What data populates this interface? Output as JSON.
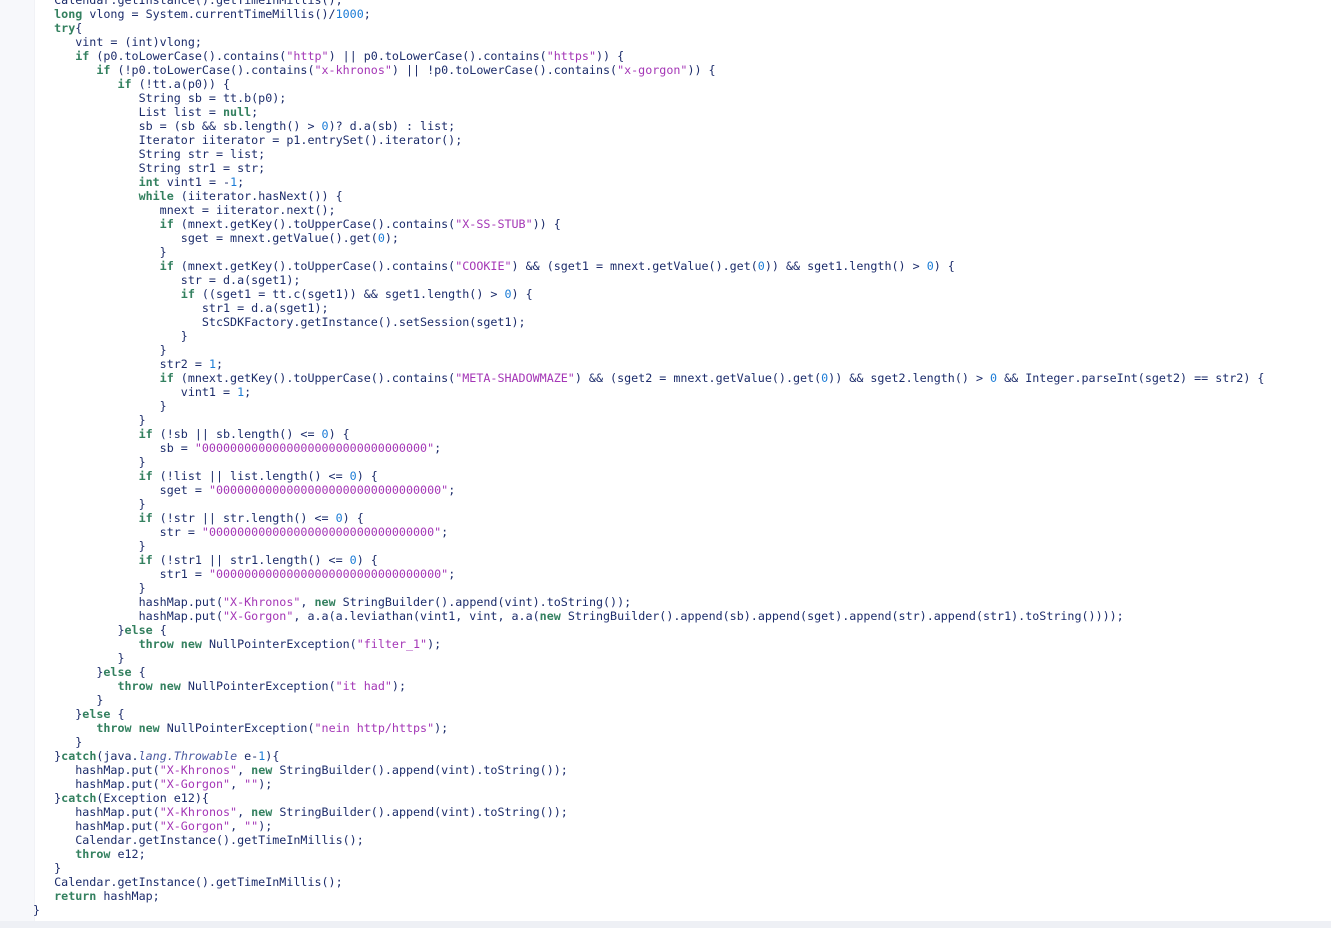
{
  "editor": {
    "language": "java",
    "lines": [
      {
        "indent": 1,
        "segs": [
          [
            "p",
            "Calendar.getInstance().getTimeInMillis();"
          ]
        ]
      },
      {
        "indent": 1,
        "segs": [
          [
            "k",
            "long"
          ],
          [
            "p",
            " vlong = System.currentTimeMillis()/"
          ],
          [
            "n",
            "1000"
          ],
          [
            "p",
            ";"
          ]
        ]
      },
      {
        "indent": 1,
        "segs": [
          [
            "k",
            "try"
          ],
          [
            "p",
            "{"
          ]
        ]
      },
      {
        "indent": 2,
        "segs": [
          [
            "p",
            "vint = (int)vlong;"
          ]
        ]
      },
      {
        "indent": 2,
        "segs": [
          [
            "k",
            "if"
          ],
          [
            "p",
            " (p0.toLowerCase().contains("
          ],
          [
            "s",
            "\"http\""
          ],
          [
            "p",
            ") || p0.toLowerCase().contains("
          ],
          [
            "s",
            "\"https\""
          ],
          [
            "p",
            ")) {"
          ]
        ]
      },
      {
        "indent": 3,
        "segs": [
          [
            "k",
            "if"
          ],
          [
            "p",
            " (!p0.toLowerCase().contains("
          ],
          [
            "s",
            "\"x-khronos\""
          ],
          [
            "p",
            ") || !p0.toLowerCase().contains("
          ],
          [
            "s",
            "\"x-gorgon\""
          ],
          [
            "p",
            ")) {"
          ]
        ]
      },
      {
        "indent": 4,
        "segs": [
          [
            "k",
            "if"
          ],
          [
            "p",
            " (!tt.a(p0)) {"
          ]
        ]
      },
      {
        "indent": 5,
        "segs": [
          [
            "p",
            "String sb = tt.b(p0);"
          ]
        ]
      },
      {
        "indent": 5,
        "segs": [
          [
            "p",
            "List list = "
          ],
          [
            "k",
            "null"
          ],
          [
            "p",
            ";"
          ]
        ]
      },
      {
        "indent": 5,
        "segs": [
          [
            "p",
            "sb = (sb && sb.length() > "
          ],
          [
            "n",
            "0"
          ],
          [
            "p",
            ")? d.a(sb) : list;"
          ]
        ]
      },
      {
        "indent": 5,
        "segs": [
          [
            "p",
            "Iterator iiterator = p1.entrySet().iterator();"
          ]
        ]
      },
      {
        "indent": 5,
        "segs": [
          [
            "p",
            "String str = list;"
          ]
        ]
      },
      {
        "indent": 5,
        "segs": [
          [
            "p",
            "String str1 = str;"
          ]
        ]
      },
      {
        "indent": 5,
        "segs": [
          [
            "k",
            "int"
          ],
          [
            "p",
            " vint1 = -"
          ],
          [
            "n",
            "1"
          ],
          [
            "p",
            ";"
          ]
        ]
      },
      {
        "indent": 5,
        "segs": [
          [
            "k",
            "while"
          ],
          [
            "p",
            " (iiterator.hasNext()) {"
          ]
        ]
      },
      {
        "indent": 6,
        "segs": [
          [
            "p",
            "mnext = iiterator.next();"
          ]
        ]
      },
      {
        "indent": 6,
        "segs": [
          [
            "k",
            "if"
          ],
          [
            "p",
            " (mnext.getKey().toUpperCase().contains("
          ],
          [
            "s",
            "\"X-SS-STUB\""
          ],
          [
            "p",
            ")) {"
          ]
        ]
      },
      {
        "indent": 7,
        "segs": [
          [
            "p",
            "sget = mnext.getValue().get("
          ],
          [
            "n",
            "0"
          ],
          [
            "p",
            ");"
          ]
        ]
      },
      {
        "indent": 6,
        "segs": [
          [
            "p",
            "}"
          ]
        ]
      },
      {
        "indent": 6,
        "segs": [
          [
            "k",
            "if"
          ],
          [
            "p",
            " (mnext.getKey().toUpperCase().contains("
          ],
          [
            "s",
            "\"COOKIE\""
          ],
          [
            "p",
            ") && (sget1 = mnext.getValue().get("
          ],
          [
            "n",
            "0"
          ],
          [
            "p",
            ")) && sget1.length() > "
          ],
          [
            "n",
            "0"
          ],
          [
            "p",
            ") {"
          ]
        ]
      },
      {
        "indent": 7,
        "segs": [
          [
            "p",
            "str = d.a(sget1);"
          ]
        ]
      },
      {
        "indent": 7,
        "segs": [
          [
            "k",
            "if"
          ],
          [
            "p",
            " ((sget1 = tt.c(sget1)) && sget1.length() > "
          ],
          [
            "n",
            "0"
          ],
          [
            "p",
            ") {"
          ]
        ]
      },
      {
        "indent": 8,
        "segs": [
          [
            "p",
            "str1 = d.a(sget1);"
          ]
        ]
      },
      {
        "indent": 8,
        "segs": [
          [
            "p",
            "StcSDKFactory.getInstance().setSession(sget1);"
          ]
        ]
      },
      {
        "indent": 7,
        "segs": [
          [
            "p",
            "}"
          ]
        ]
      },
      {
        "indent": 6,
        "segs": [
          [
            "p",
            "}"
          ]
        ]
      },
      {
        "indent": 6,
        "segs": [
          [
            "p",
            "str2 = "
          ],
          [
            "n",
            "1"
          ],
          [
            "p",
            ";"
          ]
        ]
      },
      {
        "indent": 6,
        "segs": [
          [
            "k",
            "if"
          ],
          [
            "p",
            " (mnext.getKey().toUpperCase().contains("
          ],
          [
            "s",
            "\"META-SHADOWMAZE\""
          ],
          [
            "p",
            ") && (sget2 = mnext.getValue().get("
          ],
          [
            "n",
            "0"
          ],
          [
            "p",
            ")) && sget2.length() > "
          ],
          [
            "n",
            "0"
          ],
          [
            "p",
            " && Integer.parseInt(sget2) == str2) {"
          ]
        ]
      },
      {
        "indent": 7,
        "segs": [
          [
            "p",
            "vint1 = "
          ],
          [
            "n",
            "1"
          ],
          [
            "p",
            ";"
          ]
        ]
      },
      {
        "indent": 6,
        "segs": [
          [
            "p",
            "}"
          ]
        ]
      },
      {
        "indent": 5,
        "segs": [
          [
            "p",
            "}"
          ]
        ]
      },
      {
        "indent": 5,
        "segs": [
          [
            "k",
            "if"
          ],
          [
            "p",
            " (!sb || sb.length() <= "
          ],
          [
            "n",
            "0"
          ],
          [
            "p",
            ") {"
          ]
        ]
      },
      {
        "indent": 6,
        "segs": [
          [
            "p",
            "sb = "
          ],
          [
            "s",
            "\"00000000000000000000000000000000\""
          ],
          [
            "p",
            ";"
          ]
        ]
      },
      {
        "indent": 5,
        "segs": [
          [
            "p",
            "}"
          ]
        ]
      },
      {
        "indent": 5,
        "segs": [
          [
            "k",
            "if"
          ],
          [
            "p",
            " (!list || list.length() <= "
          ],
          [
            "n",
            "0"
          ],
          [
            "p",
            ") {"
          ]
        ]
      },
      {
        "indent": 6,
        "segs": [
          [
            "p",
            "sget = "
          ],
          [
            "s",
            "\"00000000000000000000000000000000\""
          ],
          [
            "p",
            ";"
          ]
        ]
      },
      {
        "indent": 5,
        "segs": [
          [
            "p",
            "}"
          ]
        ]
      },
      {
        "indent": 5,
        "segs": [
          [
            "k",
            "if"
          ],
          [
            "p",
            " (!str || str.length() <= "
          ],
          [
            "n",
            "0"
          ],
          [
            "p",
            ") {"
          ]
        ]
      },
      {
        "indent": 6,
        "segs": [
          [
            "p",
            "str = "
          ],
          [
            "s",
            "\"00000000000000000000000000000000\""
          ],
          [
            "p",
            ";"
          ]
        ]
      },
      {
        "indent": 5,
        "segs": [
          [
            "p",
            "}"
          ]
        ]
      },
      {
        "indent": 5,
        "segs": [
          [
            "k",
            "if"
          ],
          [
            "p",
            " (!str1 || str1.length() <= "
          ],
          [
            "n",
            "0"
          ],
          [
            "p",
            ") {"
          ]
        ]
      },
      {
        "indent": 6,
        "segs": [
          [
            "p",
            "str1 = "
          ],
          [
            "s",
            "\"00000000000000000000000000000000\""
          ],
          [
            "p",
            ";"
          ]
        ]
      },
      {
        "indent": 5,
        "segs": [
          [
            "p",
            "}"
          ]
        ]
      },
      {
        "indent": 5,
        "segs": [
          [
            "p",
            "hashMap.put("
          ],
          [
            "s",
            "\"X-Khronos\""
          ],
          [
            "p",
            ", "
          ],
          [
            "k",
            "new"
          ],
          [
            "p",
            " StringBuilder().append(vint).toString());"
          ]
        ]
      },
      {
        "indent": 5,
        "segs": [
          [
            "p",
            "hashMap.put("
          ],
          [
            "s",
            "\"X-Gorgon\""
          ],
          [
            "p",
            ", a.a(a.leviathan(vint1, vint, a.a("
          ],
          [
            "k",
            "new"
          ],
          [
            "p",
            " StringBuilder().append(sb).append(sget).append(str).append(str1).toString())));"
          ]
        ]
      },
      {
        "indent": 4,
        "segs": [
          [
            "p",
            "}"
          ],
          [
            "k",
            "else"
          ],
          [
            "p",
            " {"
          ]
        ]
      },
      {
        "indent": 5,
        "segs": [
          [
            "k",
            "throw new"
          ],
          [
            "p",
            " NullPointerException("
          ],
          [
            "s",
            "\"filter_1\""
          ],
          [
            "p",
            ");"
          ]
        ]
      },
      {
        "indent": 4,
        "segs": [
          [
            "p",
            "}"
          ]
        ]
      },
      {
        "indent": 3,
        "segs": [
          [
            "p",
            "}"
          ],
          [
            "k",
            "else"
          ],
          [
            "p",
            " {"
          ]
        ]
      },
      {
        "indent": 4,
        "segs": [
          [
            "k",
            "throw new"
          ],
          [
            "p",
            " NullPointerException("
          ],
          [
            "s",
            "\"it had\""
          ],
          [
            "p",
            ");"
          ]
        ]
      },
      {
        "indent": 3,
        "segs": [
          [
            "p",
            "}"
          ]
        ]
      },
      {
        "indent": 2,
        "segs": [
          [
            "p",
            "}"
          ],
          [
            "k",
            "else"
          ],
          [
            "p",
            " {"
          ]
        ]
      },
      {
        "indent": 3,
        "segs": [
          [
            "k",
            "throw new"
          ],
          [
            "p",
            " NullPointerException("
          ],
          [
            "s",
            "\"nein http/https\""
          ],
          [
            "p",
            ");"
          ]
        ]
      },
      {
        "indent": 2,
        "segs": [
          [
            "p",
            "}"
          ]
        ]
      },
      {
        "indent": 1,
        "segs": [
          [
            "p",
            "}"
          ],
          [
            "k",
            "catch"
          ],
          [
            "p",
            "(java."
          ],
          [
            "i",
            "lang.Throwable"
          ],
          [
            "p",
            " e-"
          ],
          [
            "n",
            "1"
          ],
          [
            "p",
            "){"
          ]
        ]
      },
      {
        "indent": 2,
        "segs": [
          [
            "p",
            "hashMap.put("
          ],
          [
            "s",
            "\"X-Khronos\""
          ],
          [
            "p",
            ", "
          ],
          [
            "k",
            "new"
          ],
          [
            "p",
            " StringBuilder().append(vint).toString());"
          ]
        ]
      },
      {
        "indent": 2,
        "segs": [
          [
            "p",
            "hashMap.put("
          ],
          [
            "s",
            "\"X-Gorgon\""
          ],
          [
            "p",
            ", "
          ],
          [
            "s",
            "\"\""
          ],
          [
            "p",
            ");"
          ]
        ]
      },
      {
        "indent": 1,
        "segs": [
          [
            "p",
            "}"
          ],
          [
            "k",
            "catch"
          ],
          [
            "p",
            "(Exception e12){"
          ]
        ]
      },
      {
        "indent": 2,
        "segs": [
          [
            "p",
            "hashMap.put("
          ],
          [
            "s",
            "\"X-Khronos\""
          ],
          [
            "p",
            ", "
          ],
          [
            "k",
            "new"
          ],
          [
            "p",
            " StringBuilder().append(vint).toString());"
          ]
        ]
      },
      {
        "indent": 2,
        "segs": [
          [
            "p",
            "hashMap.put("
          ],
          [
            "s",
            "\"X-Gorgon\""
          ],
          [
            "p",
            ", "
          ],
          [
            "s",
            "\"\""
          ],
          [
            "p",
            ");"
          ]
        ]
      },
      {
        "indent": 2,
        "segs": [
          [
            "p",
            "Calendar.getInstance().getTimeInMillis();"
          ]
        ]
      },
      {
        "indent": 2,
        "segs": [
          [
            "k",
            "throw"
          ],
          [
            "p",
            " e12;"
          ]
        ]
      },
      {
        "indent": 1,
        "segs": [
          [
            "p",
            "}"
          ]
        ]
      },
      {
        "indent": 1,
        "segs": [
          [
            "p",
            "Calendar.getInstance().getTimeInMillis();"
          ]
        ]
      },
      {
        "indent": 1,
        "segs": [
          [
            "k",
            "return"
          ],
          [
            "p",
            " hashMap;"
          ]
        ]
      },
      {
        "indent": 0,
        "segs": [
          [
            "p",
            "}"
          ]
        ]
      }
    ]
  },
  "colors": {
    "background": "#ffffff",
    "plain_text": "#1c2c6b",
    "keyword": "#33805f",
    "string": "#a436b6",
    "number": "#1a7bd6",
    "gutter": "#f7f8fb"
  }
}
